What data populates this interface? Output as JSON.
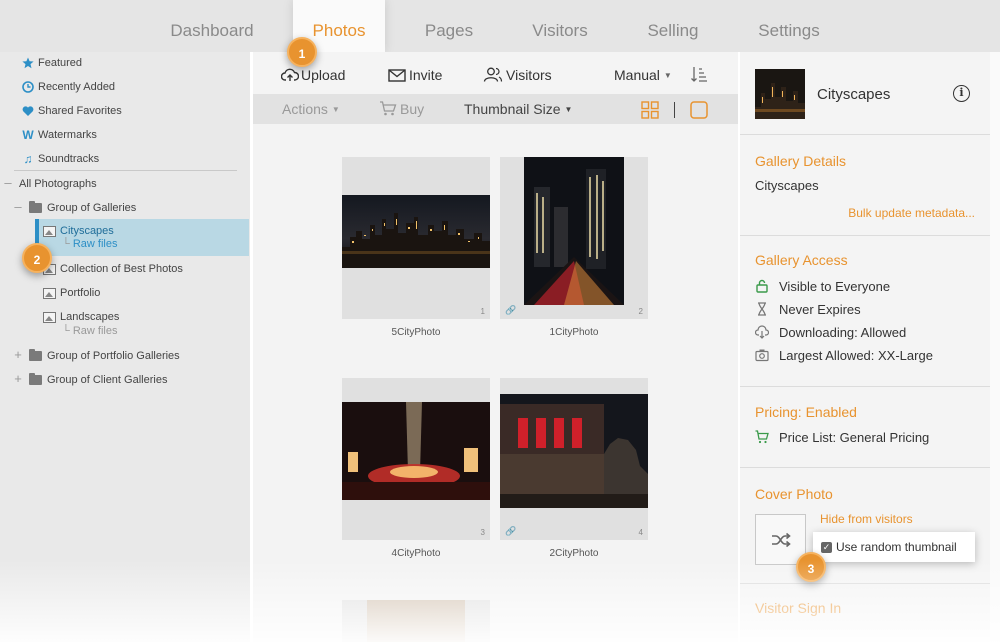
{
  "nav": {
    "tabs": [
      {
        "label": "Dashboard"
      },
      {
        "label": "Photos"
      },
      {
        "label": "Pages"
      },
      {
        "label": "Visitors"
      },
      {
        "label": "Selling"
      },
      {
        "label": "Settings"
      }
    ],
    "active_tab": "Photos"
  },
  "sidebar": {
    "quick_links": [
      {
        "label": "Featured",
        "icon": "star-icon"
      },
      {
        "label": "Recently Added",
        "icon": "clock-icon"
      },
      {
        "label": "Shared Favorites",
        "icon": "heart-icon"
      },
      {
        "label": "Watermarks",
        "icon": "watermark-icon"
      },
      {
        "label": "Soundtracks",
        "icon": "music-note-icon"
      }
    ],
    "all_photographs": "All Photographs",
    "group_of_galleries": "Group of Galleries",
    "cityscapes": "Cityscapes",
    "cityscapes_raw": "Raw files",
    "collection_best": "Collection of Best Photos",
    "portfolio": "Portfolio",
    "landscapes": "Landscapes",
    "landscapes_raw": "Raw files",
    "group_portfolio": "Group of Portfolio Galleries",
    "group_client": "Group of Client Galleries"
  },
  "toolbar": {
    "upload": "Upload",
    "invite": "Invite",
    "visitors": "Visitors",
    "sort": "Manual",
    "actions": "Actions",
    "buy": "Buy",
    "thumbnail_size": "Thumbnail Size"
  },
  "photos": [
    {
      "name": "5CityPhoto",
      "number": "1"
    },
    {
      "name": "1CityPhoto",
      "number": "2"
    },
    {
      "name": "4CityPhoto",
      "number": "3"
    },
    {
      "name": "2CityPhoto",
      "number": "4"
    }
  ],
  "panel": {
    "gallery_name": "Cityscapes",
    "details_heading": "Gallery Details",
    "details_name": "Cityscapes",
    "bulk_update": "Bulk update metadata...",
    "access_heading": "Gallery Access",
    "access_items": [
      {
        "label": "Visible to Everyone",
        "icon": "unlock-icon"
      },
      {
        "label": "Never Expires",
        "icon": "hourglass-icon"
      },
      {
        "label": "Downloading: Allowed",
        "icon": "cloud-download-icon"
      },
      {
        "label": "Largest Allowed: XX-Large",
        "icon": "camera-icon"
      }
    ],
    "pricing_heading": "Pricing: Enabled",
    "price_list": "Price List: General Pricing",
    "cover_heading": "Cover Photo",
    "hide_from_visitors": "Hide from visitors",
    "use_random": "Use random thumbnail",
    "visitor_sign_in": "Visitor Sign In"
  },
  "badges": [
    "1",
    "2",
    "3"
  ],
  "colors": {
    "accent": "#e8932f",
    "selection": "#b9d8e4",
    "selection_bar": "#2d8fc6",
    "link_blue": "#2d8fc6"
  }
}
